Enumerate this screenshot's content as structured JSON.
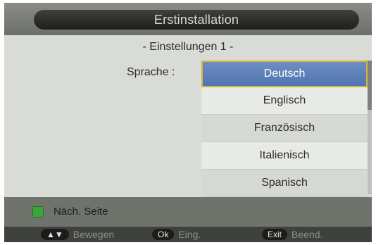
{
  "header": {
    "title": "Erstinstallation"
  },
  "settings": {
    "subtitle": "- Einstellungen 1 -",
    "language_label": "Sprache :",
    "options": [
      {
        "label": "Deutsch",
        "selected": true
      },
      {
        "label": "Englisch"
      },
      {
        "label": "Französisch"
      },
      {
        "label": "Italienisch"
      },
      {
        "label": "Spanisch"
      }
    ]
  },
  "footer": {
    "next_page": "Näch. Seite",
    "hints": [
      {
        "key": "▲▼",
        "label": "Bewegen"
      },
      {
        "key": "Ok",
        "label": "Eing."
      },
      {
        "key": "Exit",
        "label": "Beend."
      }
    ]
  },
  "colors": {
    "selected": "#5a7fbb",
    "selected_border": "#d9b43a",
    "green_key": "#3aa53a"
  }
}
